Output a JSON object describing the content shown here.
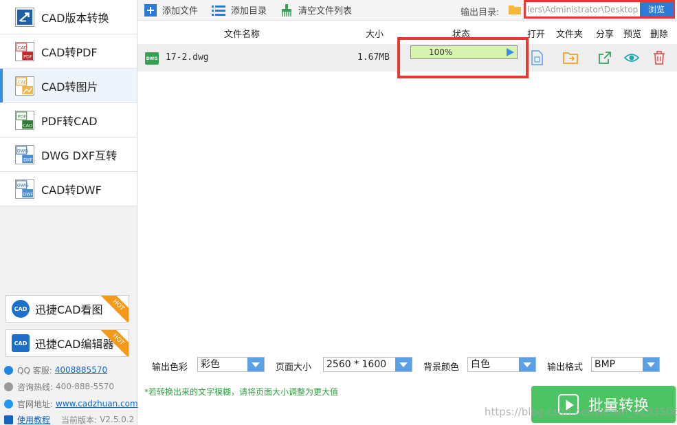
{
  "sidebar": {
    "items": [
      {
        "label": "CAD版本转换",
        "icon": "cad-version-icon",
        "active": false
      },
      {
        "label": "CAD转PDF",
        "icon": "cad-to-pdf-icon",
        "active": false
      },
      {
        "label": "CAD转图片",
        "icon": "cad-to-image-icon",
        "active": true
      },
      {
        "label": "PDF转CAD",
        "icon": "pdf-to-cad-icon",
        "active": false
      },
      {
        "label": "DWG DXF互转",
        "icon": "dwg-dxf-icon",
        "active": false
      },
      {
        "label": "CAD转DWF",
        "icon": "cad-to-dwf-icon",
        "active": false
      }
    ],
    "promos": [
      {
        "label": "迅捷CAD看图",
        "icon_text": "CAD",
        "badge": "HOT"
      },
      {
        "label": "迅捷CAD编辑器",
        "icon_text": "CAD",
        "badge": "HOT"
      }
    ],
    "info": {
      "qq_label": "QQ 客服:",
      "qq_value": "4008885570",
      "hotline_label": "咨询热线:",
      "hotline_value": "400-888-5570",
      "site_label": "官网地址:",
      "site_value": "www.cadzhuan.com",
      "tutorial_label": "使用教程",
      "version_label": "当前版本:",
      "version_value": "V2.5.0.2"
    }
  },
  "toolbar": {
    "add_file": "添加文件",
    "add_folder": "添加目录",
    "clear_list": "清空文件列表",
    "output_label": "输出目录:",
    "output_path": "lers\\Administrator\\Desktop",
    "browse": "浏览"
  },
  "table": {
    "headers": {
      "name": "文件名称",
      "size": "大小",
      "status": "状态",
      "open": "打开",
      "folder": "文件夹",
      "share": "分享",
      "preview": "预览",
      "delete": "删除"
    },
    "rows": [
      {
        "badge": "DWG",
        "name": "17-2.dwg",
        "size": "1.67MB",
        "progress_text": "100%",
        "progress": 1.0
      }
    ]
  },
  "options": {
    "color_label": "输出色彩",
    "color_value": "彩色",
    "page_size_label": "页面大小",
    "page_size_value": "2560 * 1600",
    "bg_label": "背景颜色",
    "bg_value": "白色",
    "format_label": "输出格式",
    "format_value": "BMP"
  },
  "tip": "*若转换出来的文字模糊，请将页面大小调整为更大值",
  "convert_button": "批量转换",
  "watermark": "https://blog.csdn.net/weixin_42935066",
  "colors": {
    "accent": "#2d7ad8",
    "highlight": "#e53935",
    "convert": "#4cc464",
    "progress": "#d8f2b0"
  }
}
